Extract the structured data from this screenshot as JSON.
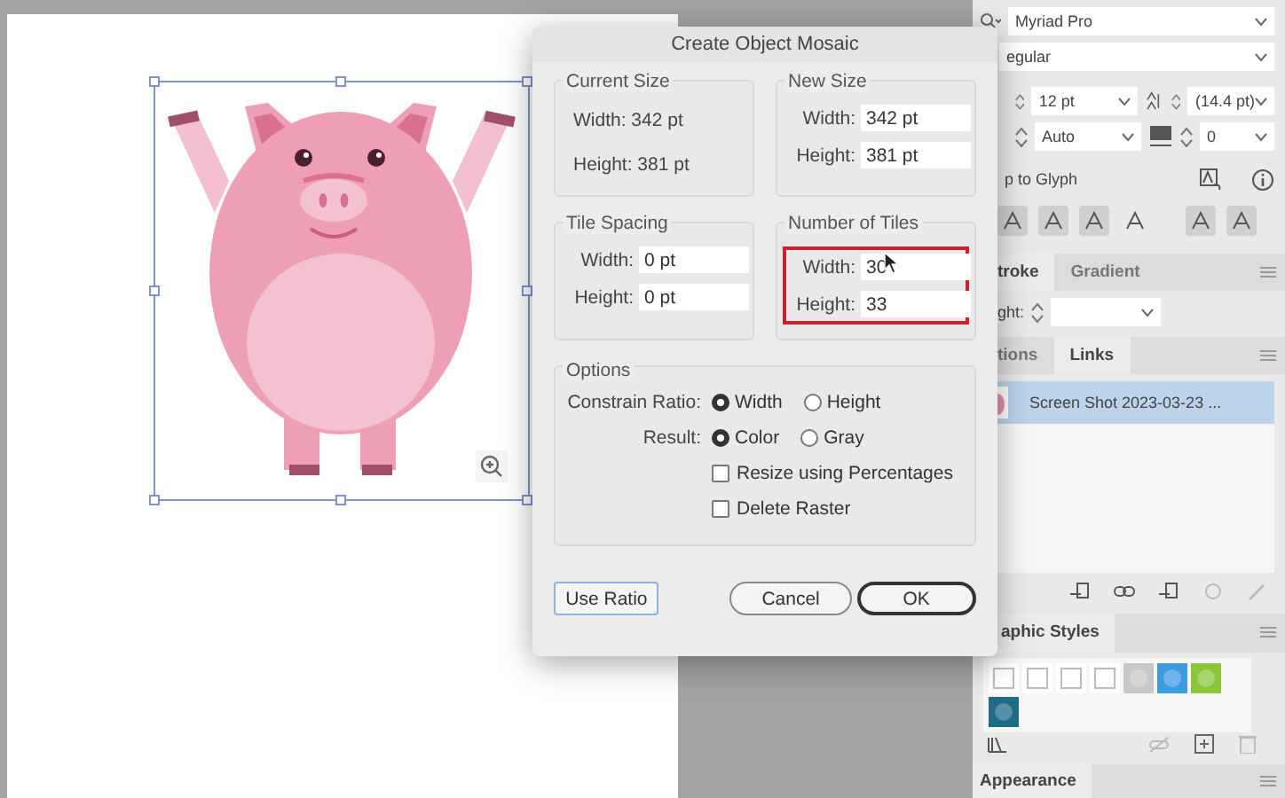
{
  "dialog": {
    "title": "Create Object Mosaic",
    "current_size": {
      "label": "Current Size",
      "lines": [
        "Width: 342 pt",
        "Height: 381 pt"
      ]
    },
    "new_size": {
      "label": "New Size",
      "highlighted": false,
      "fields": [
        {
          "label": "Width:",
          "value": "342 pt"
        },
        {
          "label": "Height:",
          "value": "381 pt"
        }
      ]
    },
    "tile_spacing": {
      "label": "Tile Spacing",
      "highlighted": false,
      "fields": [
        {
          "label": "Width:",
          "value": "0 pt"
        },
        {
          "label": "Height:",
          "value": "0 pt"
        }
      ]
    },
    "number_of_tiles": {
      "label": "Number of Tiles",
      "highlighted": true,
      "fields": [
        {
          "label": "Width:",
          "value": "30"
        },
        {
          "label": "Height:",
          "value": "33"
        }
      ]
    },
    "options": {
      "label": "Options",
      "radio_groups": [
        {
          "label": "Constrain Ratio:",
          "options": [
            {
              "label": "Width",
              "selected": true
            },
            {
              "label": "Height",
              "selected": false
            }
          ]
        },
        {
          "label": "Result:",
          "options": [
            {
              "label": "Color",
              "selected": true
            },
            {
              "label": "Gray",
              "selected": false
            }
          ]
        }
      ],
      "checkboxes": [
        {
          "label": "Resize using Percentages",
          "checked": false
        },
        {
          "label": "Delete Raster",
          "checked": false
        }
      ]
    },
    "buttons": [
      {
        "label": "Use Ratio",
        "kind": "focused"
      },
      {
        "label": "Cancel",
        "kind": "pill"
      },
      {
        "label": "OK",
        "kind": "default"
      }
    ]
  },
  "character_panel": {
    "font": "Myriad Pro",
    "style": "egular",
    "size": "12 pt",
    "leading": "(14.4 pt)",
    "kerning": "Auto",
    "tracking": "0",
    "snap_label": "p to Glyph"
  },
  "stroke_panel": {
    "tabs": [
      {
        "label": "troke",
        "selected": true
      },
      {
        "label": "Gradient",
        "selected": false
      }
    ],
    "weight_label": "ght:"
  },
  "links_panel": {
    "tabs": [
      {
        "label": "tions",
        "selected": false
      },
      {
        "label": "Links",
        "selected": true
      }
    ],
    "links": [
      {
        "name": "Screen Shot 2023-03-23 ...",
        "selected": true
      }
    ]
  },
  "graphic_styles_panel": {
    "tab": "aphic Styles"
  },
  "appearance_panel": {
    "tab": "Appearance"
  }
}
